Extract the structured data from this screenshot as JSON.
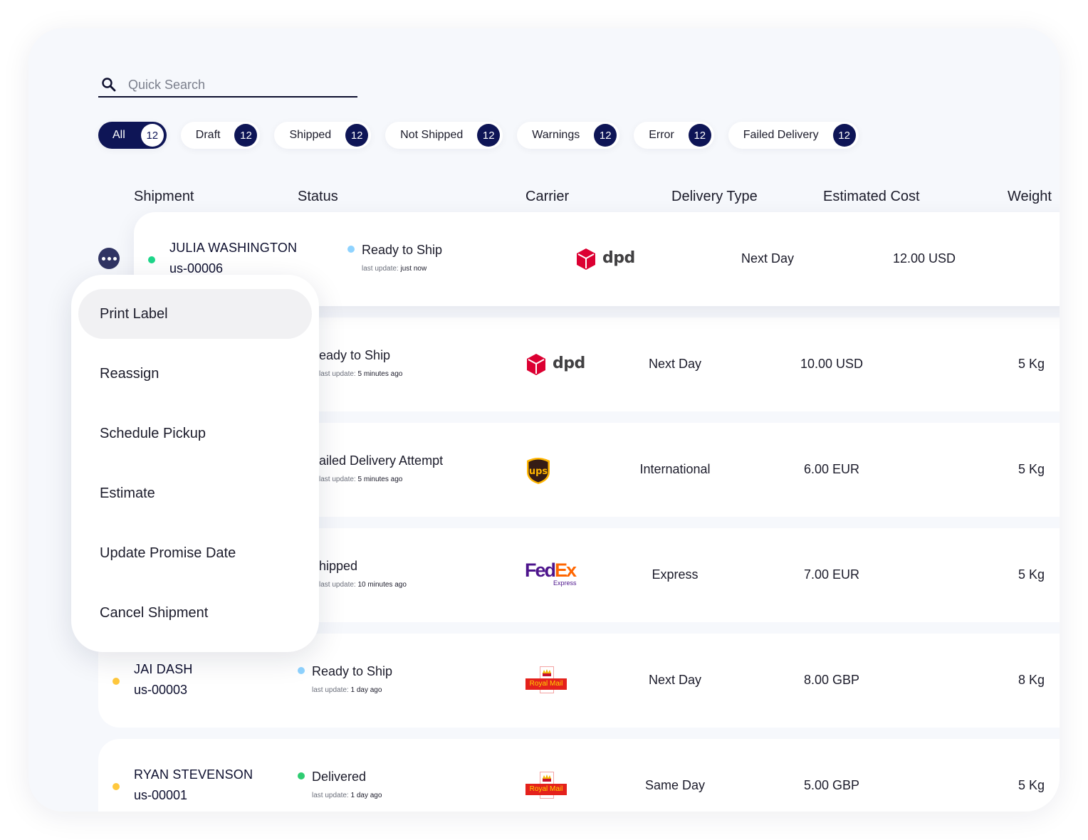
{
  "search": {
    "placeholder": "Quick Search",
    "value": ""
  },
  "filters": [
    {
      "label": "All",
      "count": "12",
      "active": true
    },
    {
      "label": "Draft",
      "count": "12"
    },
    {
      "label": "Shipped",
      "count": "12"
    },
    {
      "label": "Not Shipped",
      "count": "12"
    },
    {
      "label": "Warnings",
      "count": "12"
    },
    {
      "label": "Error",
      "count": "12"
    },
    {
      "label": "Failed Delivery",
      "count": "12"
    }
  ],
  "columns": {
    "shipment": "Shipment",
    "status": "Status",
    "carrier": "Carrier",
    "delivery_type": "Delivery Type",
    "estimated_cost": "Estimated Cost",
    "weight": "Weight"
  },
  "last_update_label": "last update:",
  "rows": [
    {
      "name": "JULIA WASHINGTON",
      "id": "us-00006",
      "indicator_color": "#1ed68a",
      "status": "Ready to Ship",
      "status_color": "#8fd3ff",
      "last_update": "just now",
      "carrier": "dpd",
      "delivery_type": "Next Day",
      "cost": "12.00 USD",
      "weight": ""
    },
    {
      "name": "",
      "id": "",
      "status": "Ready to Ship",
      "status_visible": "eady to Ship",
      "last_update": "5 minutes ago",
      "carrier": "dpd",
      "delivery_type": "Next Day",
      "cost": "10.00 USD",
      "weight": "5 Kg"
    },
    {
      "name": "",
      "id": "",
      "status": "Failed Delivery Attempt",
      "status_visible": "ailed Delivery Attempt",
      "last_update": "5 minutes ago",
      "carrier": "ups",
      "delivery_type": "International",
      "cost": "6.00 EUR",
      "weight": "5 Kg"
    },
    {
      "name": "",
      "id": "",
      "status": "Shipped",
      "status_visible": "hipped",
      "last_update": "10 minutes ago",
      "carrier": "fedex",
      "delivery_type": "Express",
      "cost": "7.00 EUR",
      "weight": "5 Kg"
    },
    {
      "name": "JAI DASH",
      "id": "us-00003",
      "indicator_color": "#ffc83d",
      "status": "Ready to Ship",
      "status_color": "#8fd3ff",
      "last_update": "1 day ago",
      "carrier": "royal-mail",
      "delivery_type": "Next Day",
      "cost": "8.00 GBP",
      "weight": "8 Kg"
    },
    {
      "name": "RYAN STEVENSON",
      "id": "us-00001",
      "indicator_color": "#ffc83d",
      "status": "Delivered",
      "status_color": "#2ecc71",
      "last_update": "1 day ago",
      "carrier": "royal-mail",
      "delivery_type": "Same Day",
      "cost": "5.00 GBP",
      "weight": "5 Kg"
    }
  ],
  "logos": {
    "dpd": "dpd",
    "ups": "ups",
    "fedex_fed": "Fed",
    "fedex_ex": "Ex",
    "fedex_sub": "Express",
    "royal_mail": "Royal Mail"
  },
  "context_menu": {
    "items": [
      "Print Label",
      "Reassign",
      "Schedule Pickup",
      "Estimate",
      "Update Promise Date",
      "Cancel Shipment"
    ],
    "hovered_index": 0
  },
  "colors": {
    "accent": "#0e1556",
    "more_button": "#303463",
    "panel_bg": "#f6f8fc"
  }
}
